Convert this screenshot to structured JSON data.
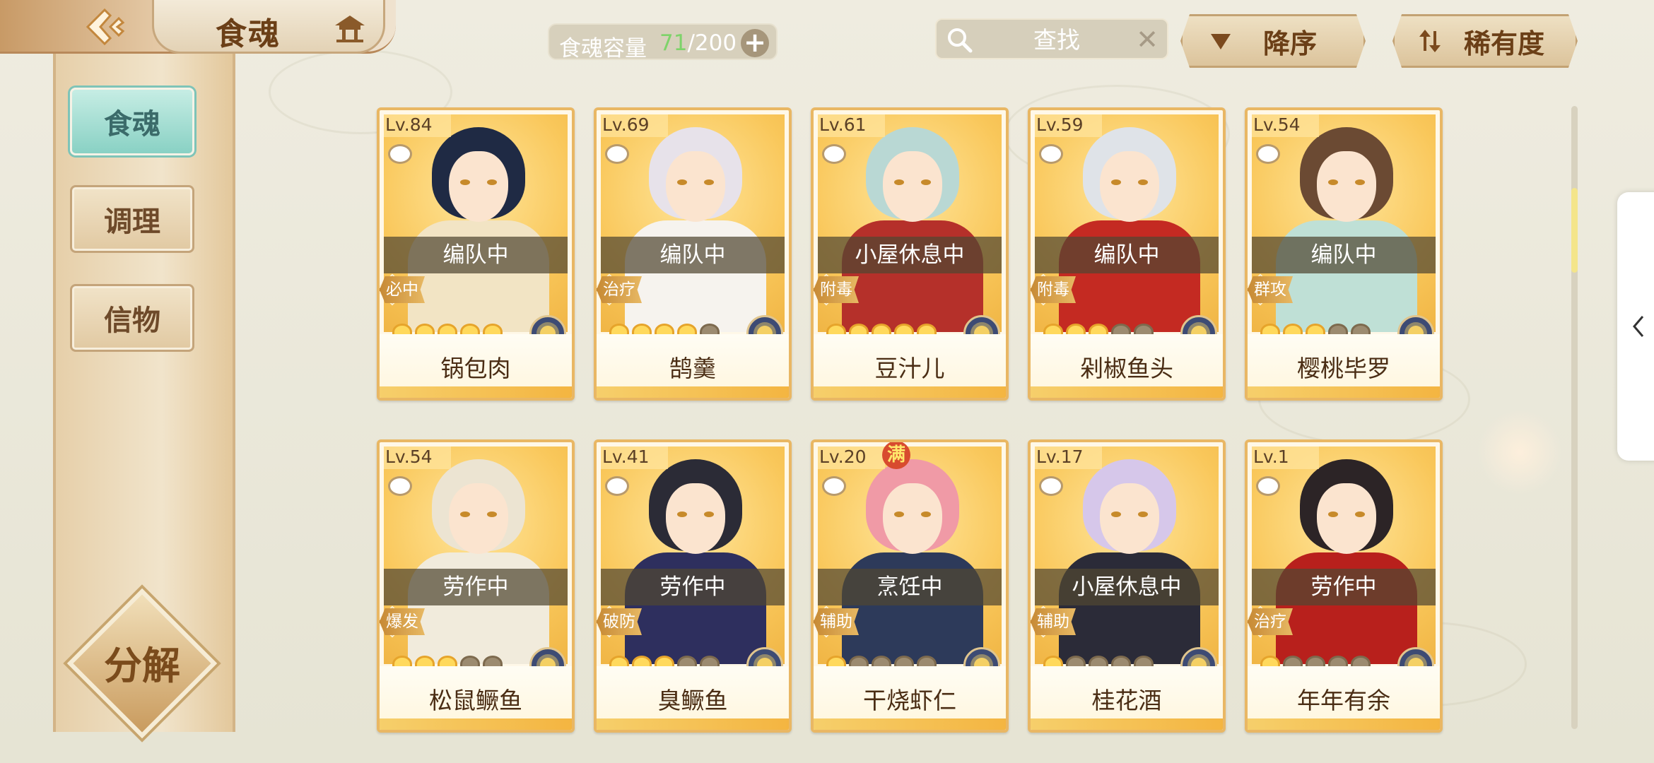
{
  "header": {
    "title": "食魂",
    "back_icon": "back-arrow-icon",
    "home_icon": "pavilion-icon"
  },
  "capacity": {
    "label": "食魂容量",
    "current": "71",
    "total": "/200",
    "add_icon": "plus-icon"
  },
  "search": {
    "placeholder": "查找",
    "clear_icon": "close-icon"
  },
  "sort": {
    "order_label": "降序",
    "rarity_label": "稀有度"
  },
  "sidebar": {
    "tabs": [
      {
        "label": "食魂",
        "active": true
      },
      {
        "label": "调理",
        "active": false
      },
      {
        "label": "信物",
        "active": false
      }
    ],
    "decompose_label": "分解"
  },
  "cards": [
    {
      "level": "Lv.84",
      "status": "编队中",
      "role": "必中",
      "name": "锅包肉",
      "stars": 5,
      "hair": "#1f2a44",
      "outfit": "#f2e4c4"
    },
    {
      "level": "Lv.69",
      "status": "编队中",
      "role": "治疗",
      "name": "鹄羹",
      "stars": 4,
      "hair": "#e7e2ea",
      "outfit": "#f6f3ee"
    },
    {
      "level": "Lv.61",
      "status": "小屋休息中",
      "role": "附毒",
      "name": "豆汁儿",
      "stars": 5,
      "hair": "#b9d8d4",
      "outfit": "#b5302a"
    },
    {
      "level": "Lv.59",
      "status": "编队中",
      "role": "附毒",
      "name": "剁椒鱼头",
      "stars": 3,
      "hair": "#dfe3e8",
      "outfit": "#c42a22"
    },
    {
      "level": "Lv.54",
      "status": "编队中",
      "role": "群攻",
      "name": "樱桃毕罗",
      "stars": 3,
      "hair": "#6b4a33",
      "outfit": "#bfe0d6"
    },
    {
      "level": "Lv.54",
      "status": "劳作中",
      "role": "爆发",
      "name": "松鼠鳜鱼",
      "stars": 3,
      "hair": "#ece4d2",
      "outfit": "#f1ebdc"
    },
    {
      "level": "Lv.41",
      "status": "劳作中",
      "role": "破防",
      "name": "臭鳜鱼",
      "stars": 3,
      "hair": "#2b2b36",
      "outfit": "#2e2f5e"
    },
    {
      "level": "Lv.20",
      "status": "烹饪中",
      "role": "辅助",
      "name": "干烧虾仁",
      "stars": 1,
      "hair": "#f09aa6",
      "outfit": "#2d3a5a",
      "max_badge": "满"
    },
    {
      "level": "Lv.17",
      "status": "小屋休息中",
      "role": "辅助",
      "name": "桂花酒",
      "stars": 1,
      "hair": "#d6c7ea",
      "outfit": "#2b2b38"
    },
    {
      "level": "Lv.1",
      "status": "劳作中",
      "role": "治疗",
      "name": "年年有余",
      "stars": 1,
      "hair": "#2c2426",
      "outfit": "#b8201c"
    }
  ],
  "colors": {
    "card_border": "#e9b764",
    "active_tab": "#89d1c4",
    "capacity_current": "#7ed36a"
  },
  "side_handle_icon": "chevron-left-icon"
}
